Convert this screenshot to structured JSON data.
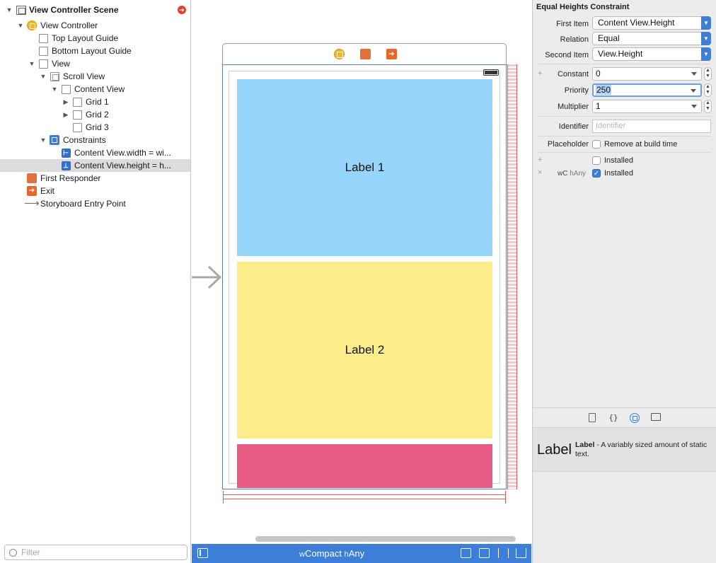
{
  "outline": {
    "rows": [
      {
        "label": "View Controller Scene",
        "disclosure": "▼",
        "icon": "scene-icon"
      },
      {
        "label": "View Controller",
        "disclosure": "▼",
        "icon": "view-controller-icon"
      },
      {
        "label": "Top Layout Guide",
        "disclosure": "",
        "icon": "layout-guide-icon"
      },
      {
        "label": "Bottom Layout Guide",
        "disclosure": "",
        "icon": "layout-guide-icon"
      },
      {
        "label": "View",
        "disclosure": "▼",
        "icon": "view-icon"
      },
      {
        "label": "Scroll View",
        "disclosure": "▼",
        "icon": "view-icon"
      },
      {
        "label": "Content View",
        "disclosure": "▼",
        "icon": "view-icon"
      },
      {
        "label": "Grid 1",
        "disclosure": "▶",
        "icon": "view-icon"
      },
      {
        "label": "Grid 2",
        "disclosure": "▶",
        "icon": "view-icon"
      },
      {
        "label": "Grid 3",
        "disclosure": "",
        "icon": "view-icon"
      },
      {
        "label": "Constraints",
        "disclosure": "▼",
        "icon": "constraints-icon"
      },
      {
        "label": "Content View.width = wi...",
        "disclosure": "",
        "icon": "constraint-icon"
      },
      {
        "label": "Content View.height = h...",
        "disclosure": "",
        "icon": "constraint-icon"
      },
      {
        "label": "First Responder",
        "disclosure": "",
        "icon": "first-responder-icon"
      },
      {
        "label": "Exit",
        "disclosure": "",
        "icon": "exit-icon"
      },
      {
        "label": "Storyboard Entry Point",
        "disclosure": "",
        "icon": "entry-arrow-icon"
      }
    ],
    "filter_placeholder": "Filter"
  },
  "canvas": {
    "grid_labels": [
      "Label 1",
      "Label 2"
    ],
    "size_class": {
      "w_prefix": "w",
      "w_value": "Compact",
      "h_prefix": "h",
      "h_value": "Any"
    },
    "colors": {
      "grid1": "#96d6fd",
      "grid2": "#fdec8a",
      "grid3": "#e65b84",
      "selection": "#3d7ed8"
    }
  },
  "inspector": {
    "title": "Equal Heights Constraint",
    "first_item_label": "First Item",
    "first_item_value": "Content View.Height",
    "relation_label": "Relation",
    "relation_value": "Equal",
    "second_item_label": "Second Item",
    "second_item_value": "View.Height",
    "constant_label": "Constant",
    "constant_value": "0",
    "priority_label": "Priority",
    "priority_value": "250",
    "multiplier_label": "Multiplier",
    "multiplier_value": "1",
    "identifier_label": "Identifier",
    "identifier_placeholder": "Identifier",
    "placeholder_label": "Placeholder",
    "placeholder_check_label": "Remove at build time",
    "installed_label": "Installed",
    "installed_variant_label": "Installed",
    "variant_w": "wC",
    "variant_h": "hAny",
    "plus": "+",
    "times": "×"
  },
  "library": {
    "item_glyph": "Label",
    "item_name": "Label",
    "item_description": "- A variably sized amount of static text."
  }
}
